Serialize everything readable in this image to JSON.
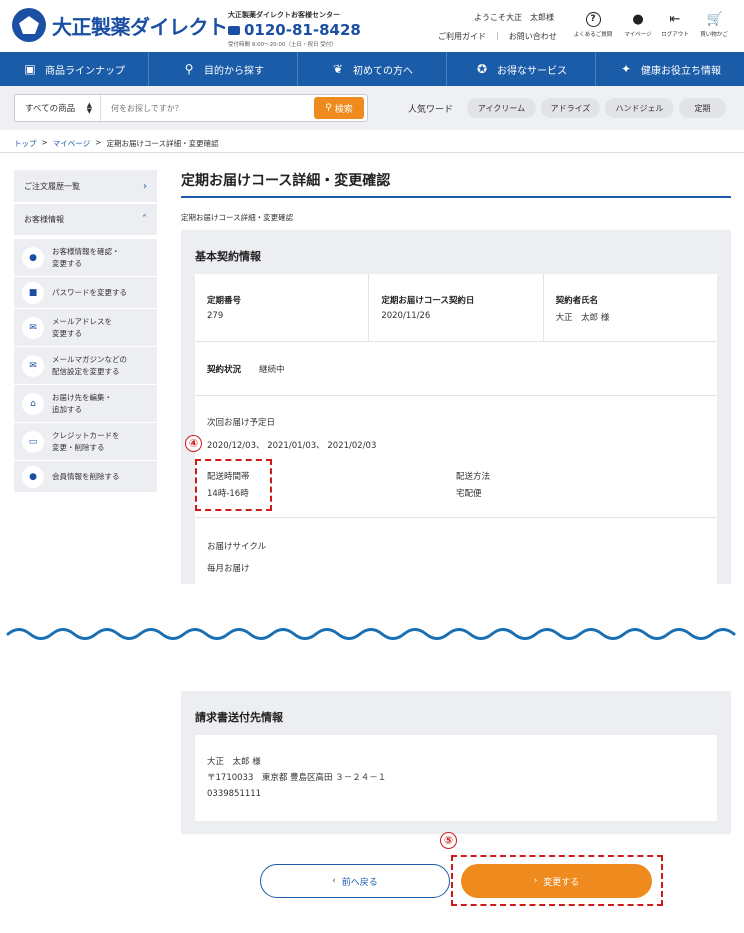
{
  "header": {
    "logo_text": "大正製薬ダイレクト",
    "tel_label": "大正製薬ダイレクトお客様センター",
    "tel_number": "0120-81-8428",
    "tel_hours": "受付時間 9:00～20:00（土日・祝日 受付）",
    "welcome": "ようこそ大正　太郎様",
    "links": [
      "ご利用ガイド",
      "お問い合わせ"
    ],
    "icons": [
      {
        "label": "よくあるご質問",
        "icon": "question-icon"
      },
      {
        "label": "マイページ",
        "icon": "person-icon"
      },
      {
        "label": "ログアウト",
        "icon": "logout-icon"
      },
      {
        "label": "買い物かご",
        "icon": "cart-icon"
      }
    ]
  },
  "nav": [
    {
      "label": "商品ラインナップ",
      "icon": "box-icon"
    },
    {
      "label": "目的から探す",
      "icon": "search-icon"
    },
    {
      "label": "初めての方へ",
      "icon": "leaf-icon"
    },
    {
      "label": "お得なサービス",
      "icon": "medal-icon"
    },
    {
      "label": "健康お役立ち情報",
      "icon": "sparkle-icon"
    }
  ],
  "search": {
    "category": "すべての商品",
    "placeholder": "何をお探しですか？",
    "button": "検索",
    "popular_label": "人気ワード",
    "chips": [
      "アイクリーム",
      "アドライズ",
      "ハンドジェル",
      "定期"
    ]
  },
  "breadcrumb": [
    "トップ",
    "マイページ",
    "定期お届けコース詳細・変更確認"
  ],
  "sidebar": {
    "order_history": "ご注文履歴一覧",
    "customer_info": "お客様情報",
    "items": [
      {
        "line1": "お客様情報を確認・",
        "line2": "変更する",
        "icon": "person-icon"
      },
      {
        "line1": "パスワードを変更する",
        "line2": "",
        "icon": "lock-icon"
      },
      {
        "line1": "メールアドレスを",
        "line2": "変更する",
        "icon": "mail-icon"
      },
      {
        "line1": "メールマガジンなどの",
        "line2": "配信設定を変更する",
        "icon": "newsletter-icon"
      },
      {
        "line1": "お届け先を編集・",
        "line2": "追加する",
        "icon": "home-icon"
      },
      {
        "line1": "クレジットカードを",
        "line2": "変更・削除する",
        "icon": "card-icon"
      },
      {
        "line1": "会員情報を削除する",
        "line2": "",
        "icon": "user-delete-icon"
      }
    ]
  },
  "main": {
    "title": "定期お届けコース詳細・変更確認",
    "sub_crumb": "定期お届けコース詳細・変更確認",
    "contract": {
      "section_title": "基本契約情報",
      "number_label": "定期番号",
      "number_value": "279",
      "date_label": "定期お届けコース契約日",
      "date_value": "2020/11/26",
      "name_label": "契約者氏名",
      "name_value": "大正　太郎 様",
      "status_label": "契約状況",
      "status_value": "継続中",
      "next_label": "次回お届け予定日",
      "next_dates": "2020/12/03、 2021/01/03、 2021/02/03",
      "time_label": "配送時間帯",
      "time_value": "14時-16時",
      "method_label": "配送方法",
      "method_value": "宅配便",
      "cycle_label": "お届けサイクル",
      "cycle_value": "毎月お届け"
    },
    "billing": {
      "section_title": "請求書送付先情報",
      "name": "大正　太郎 様",
      "address": "〒1710033　東京都 豊島区高田 ３－２４－１",
      "phone": "0339851111"
    },
    "annotations": [
      "④",
      "⑤"
    ],
    "back_button": "前へ戻る",
    "next_button": "変更する"
  },
  "colors": {
    "brand_blue": "#1a5ca8",
    "accent_orange": "#ee8a1e",
    "annotation_red": "#d01a1a"
  }
}
